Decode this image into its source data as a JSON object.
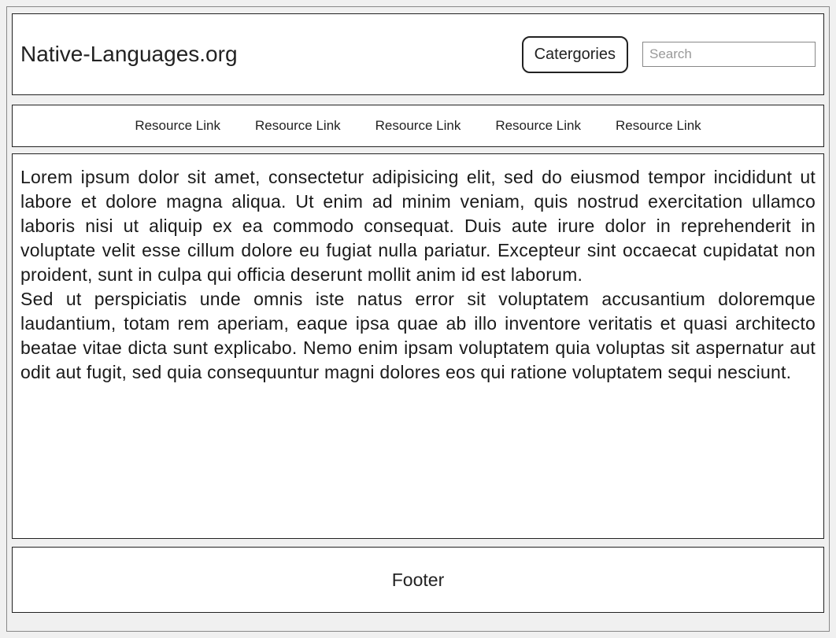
{
  "header": {
    "title": "Native-Languages.org",
    "categories_label": "Catergories",
    "search_placeholder": "Search"
  },
  "nav": {
    "links": [
      "Resource Link",
      "Resource Link",
      "Resource Link",
      "Resource Link",
      "Resource Link"
    ]
  },
  "content": {
    "paragraph1": "Lorem ipsum dolor sit amet, consectetur adipisicing elit, sed do eiusmod tempor incididunt ut labore et dolore magna aliqua. Ut enim ad minim veniam, quis nostrud exercitation ullamco laboris nisi ut aliquip ex ea commodo consequat. Duis aute irure dolor in reprehenderit in voluptate velit esse cillum dolore eu fugiat nulla pariatur. Excepteur sint occaecat cupidatat non proident, sunt in culpa qui officia deserunt mollit anim id est laborum.",
    "paragraph2": "Sed ut perspiciatis unde omnis iste natus error sit voluptatem accusantium doloremque laudantium, totam rem aperiam, eaque ipsa quae ab illo inventore veritatis et quasi architecto beatae vitae dicta sunt explicabo. Nemo enim ipsam voluptatem quia voluptas sit aspernatur aut odit aut fugit, sed quia consequuntur magni dolores eos qui ratione voluptatem sequi nesciunt."
  },
  "footer": {
    "text": "Footer"
  }
}
